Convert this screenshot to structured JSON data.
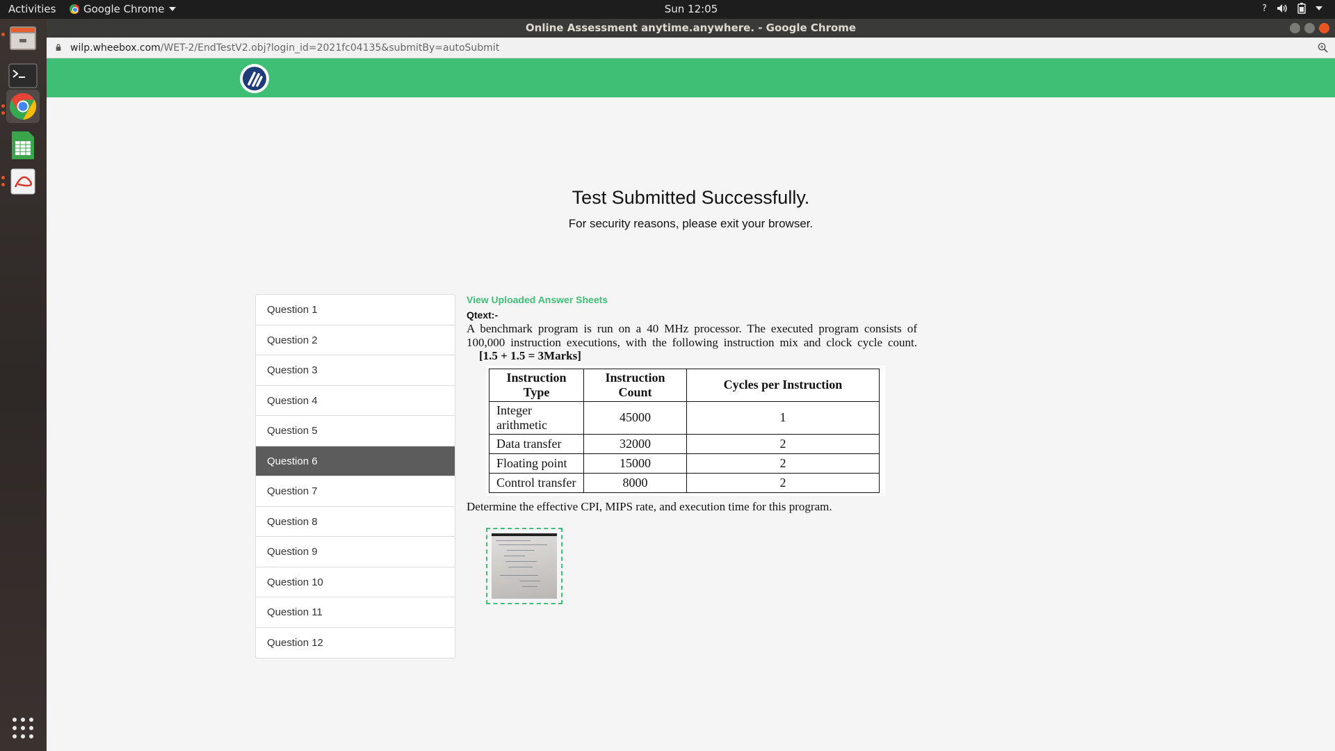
{
  "topbar": {
    "activities": "Activities",
    "app_name": "Google Chrome",
    "clock": "Sun 12:05"
  },
  "window": {
    "title": "Online Assessment anytime.anywhere. - Google Chrome"
  },
  "address": {
    "host": "wilp.wheebox.com",
    "path": "/WET-2/EndTestV2.obj?login_id=2021fc04135&submitBy=autoSubmit"
  },
  "colors": {
    "brand_green": "#3fbe76",
    "active_item": "#5c5c5c",
    "ubuntu_orange": "#e95420"
  },
  "icons": {
    "dock": [
      "files-icon",
      "terminal-icon",
      "chrome-icon",
      "spreadsheet-icon",
      "document-viewer-icon",
      "app-grid-icon"
    ],
    "tray": [
      "help-icon",
      "volume-icon",
      "battery-icon",
      "chevron-down-icon"
    ]
  },
  "message": {
    "title": "Test Submitted Successfully.",
    "subtitle": "For security reasons, please exit your browser."
  },
  "questions": {
    "active_index": 5,
    "items": [
      "Question 1",
      "Question 2",
      "Question 3",
      "Question 4",
      "Question 5",
      "Question 6",
      "Question 7",
      "Question 8",
      "Question 9",
      "Question 10",
      "Question 11",
      "Question 12"
    ]
  },
  "content": {
    "view_link": "View Uploaded Answer Sheets",
    "qtext_label": "Qtext:-",
    "question": "A benchmark program is run on a 40 MHz processor. The executed program consists of 100,000 instruction executions, with the following instruction mix and clock cycle count.",
    "marks": "[1.5 + 1.5 = 3Marks]",
    "table": {
      "headers": [
        "Instruction Type",
        "Instruction Count",
        "Cycles per Instruction"
      ],
      "rows": [
        [
          "Integer arithmetic",
          "45000",
          "1"
        ],
        [
          "Data transfer",
          "32000",
          "2"
        ],
        [
          "Floating point",
          "15000",
          "2"
        ],
        [
          "Control transfer",
          "8000",
          "2"
        ]
      ]
    },
    "determine": "Determine the effective CPI, MIPS rate, and execution time for this program."
  }
}
